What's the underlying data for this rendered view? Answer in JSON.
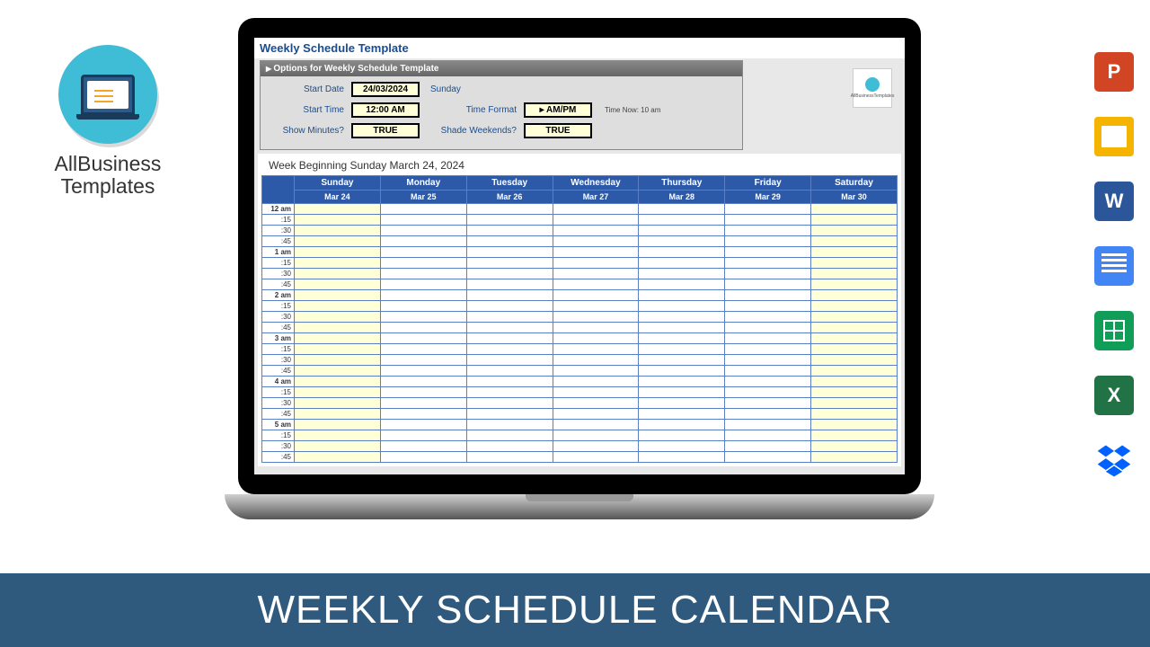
{
  "logo": {
    "name": "AllBusiness Templates"
  },
  "app": {
    "title": "Weekly Schedule Template",
    "options_header": "Options for Weekly Schedule Template",
    "labels": {
      "start_date": "Start Date",
      "start_time": "Start Time",
      "show_minutes": "Show Minutes?",
      "time_format": "Time Format",
      "shade_weekends": "Shade Weekends?",
      "time_now": "Time Now: 10 am"
    },
    "values": {
      "start_date": "24/03/2024",
      "start_date_day": "Sunday",
      "start_time": "12:00 AM",
      "show_minutes": "TRUE",
      "time_format": "▸ AM/PM",
      "shade_weekends": "TRUE"
    },
    "mini_logo": "AllBusinessTemplates"
  },
  "calendar": {
    "week_title": "Week Beginning Sunday March 24, 2024",
    "days": [
      "Sunday",
      "Monday",
      "Tuesday",
      "Wednesday",
      "Thursday",
      "Friday",
      "Saturday"
    ],
    "dates": [
      "Mar 24",
      "Mar 25",
      "Mar 26",
      "Mar 27",
      "Mar 28",
      "Mar 29",
      "Mar 30"
    ],
    "weekend_cols": [
      0,
      6
    ],
    "hours": [
      "12 am",
      "1 am",
      "2 am",
      "3 am",
      "4 am",
      "5 am"
    ],
    "minutes": [
      ":15",
      ":30",
      ":45"
    ]
  },
  "icons": {
    "ppt": "P",
    "slides": "",
    "word": "W",
    "docs": "",
    "sheets": "",
    "excel": "X",
    "dropbox": ""
  },
  "banner": {
    "title": "WEEKLY SCHEDULE CALENDAR"
  }
}
